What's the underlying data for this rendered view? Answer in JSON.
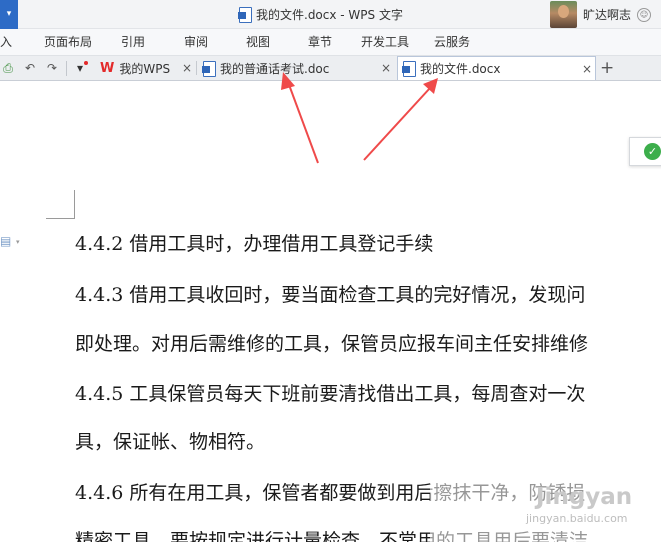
{
  "window": {
    "title": "我的文件.docx - WPS 文字",
    "user_name": "旷达啊志",
    "app_menu_glyph": "▾",
    "user_badge_glyph": "☺"
  },
  "menu": [
    "入",
    "页面布局",
    "引用",
    "审阅",
    "视图",
    "章节",
    "开发工具",
    "云服务"
  ],
  "quick_access": {
    "icons": [
      "print-preview-icon",
      "undo-icon",
      "redo-icon",
      "customize-toolbar-icon"
    ],
    "preview_glyph": "⎙",
    "undo_glyph": "↶",
    "redo_glyph": "↷",
    "customize_glyph": "▾"
  },
  "tabs": [
    {
      "label": "我的WPS",
      "logo": "W",
      "close": "×",
      "active": false
    },
    {
      "label": "我的普通话考试.doc",
      "close": "×",
      "active": false
    },
    {
      "label": "我的文件.docx",
      "close": "×",
      "active": true
    }
  ],
  "new_tab_label": "+",
  "document": {
    "paragraphs": [
      "4.4.2 借用工具时，办理借用工具登记手续",
      "4.4.3 借用工具收回时，要当面检查工具的完好情况，发现问",
      "即处理。对用后需维修的工具，保管员应报车间主任安排维修",
      "4.4.5 工具保管员每天下班前要清找借出工具，每周查对一次",
      "具，保证帐、物相符。",
      "4.4.6 所有在用工具，保管者都要做到用后擦抹干净，防锈损",
      "精密工具，要按规定进行计量检查。不常用的工具用后要清洁"
    ],
    "side_glyph": "▤",
    "side_caret": "▾",
    "check_glyph": "✓"
  },
  "watermark": {
    "logo": "Jingyan",
    "url": "jingyan.baidu.com"
  },
  "colors": {
    "accent": "#2d6bc6",
    "arrow": "#ef4a4a",
    "saved": "#3cae4b",
    "wps_red": "#e32a2a"
  }
}
